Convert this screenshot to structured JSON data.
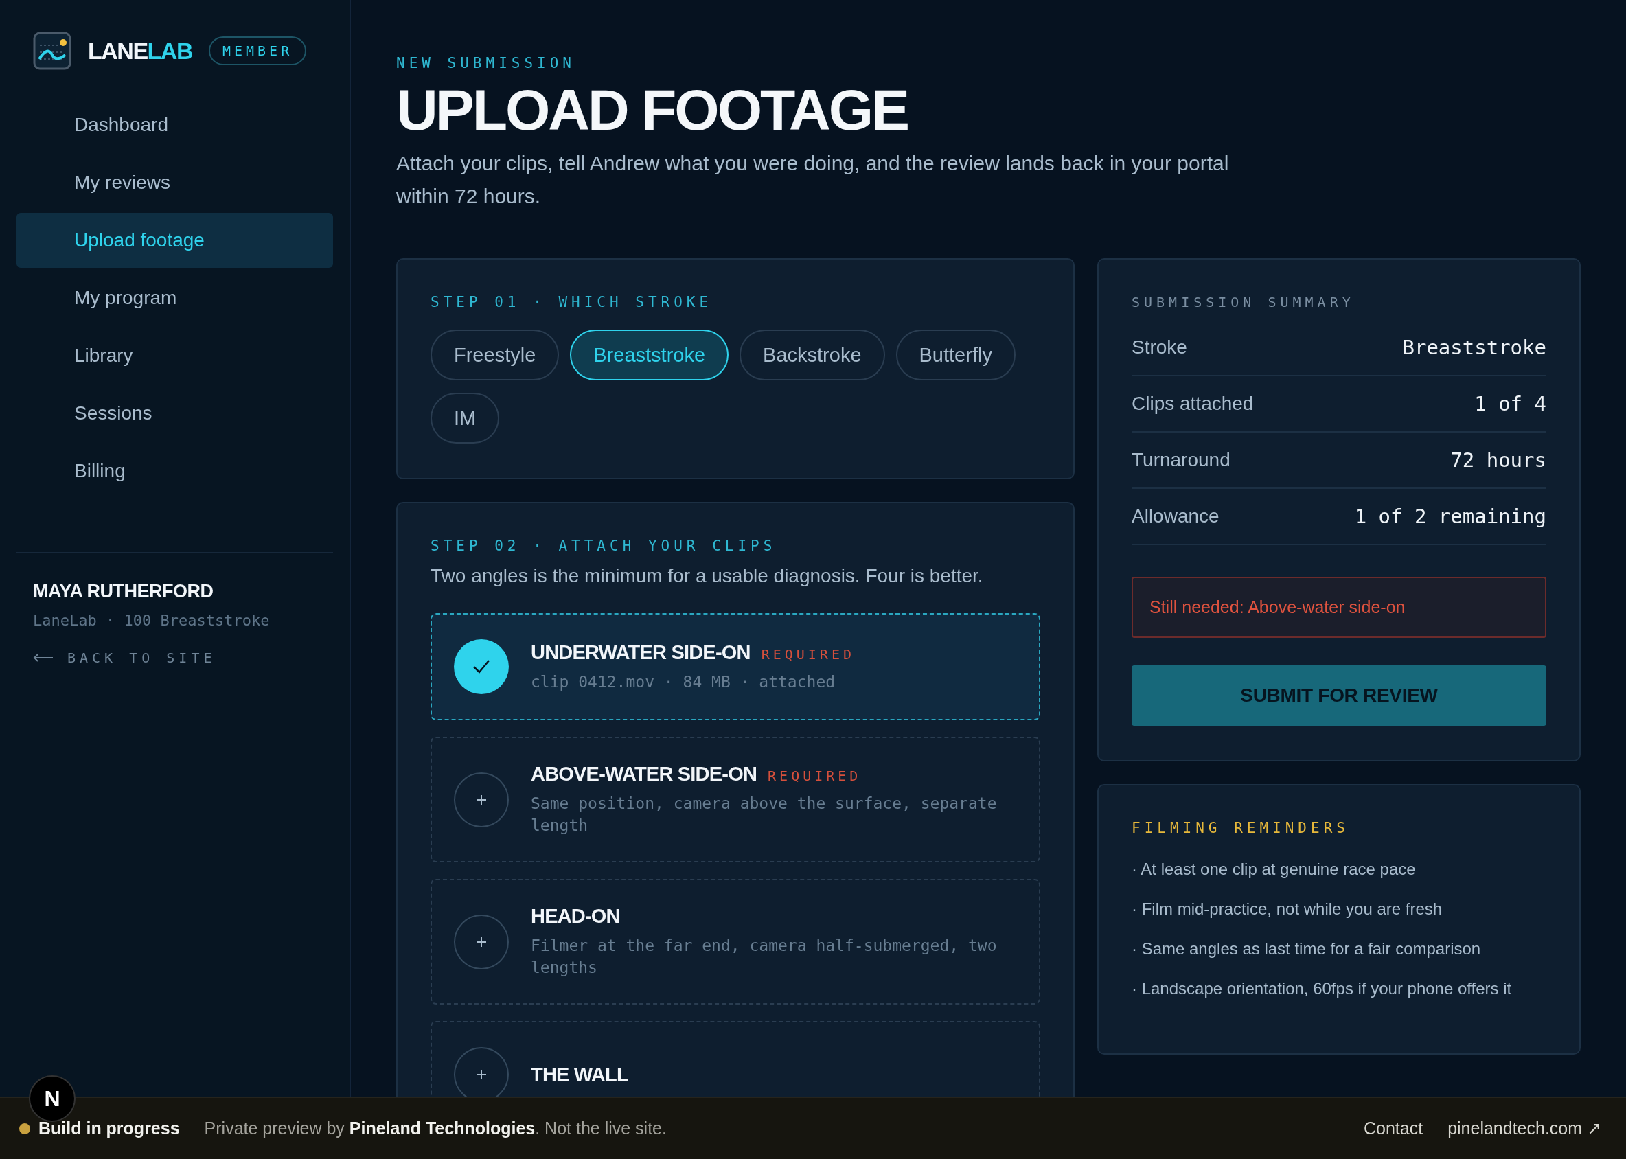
{
  "brand": {
    "name_primary": "LANE",
    "name_accent": "LAB",
    "badge": "MEMBER"
  },
  "nav": [
    {
      "label": "Dashboard",
      "selected": false
    },
    {
      "label": "My reviews",
      "selected": false
    },
    {
      "label": "Upload footage",
      "selected": true
    },
    {
      "label": "My program",
      "selected": false
    },
    {
      "label": "Library",
      "selected": false
    },
    {
      "label": "Sessions",
      "selected": false
    },
    {
      "label": "Billing",
      "selected": false
    }
  ],
  "user": {
    "name": "MAYA RUTHERFORD",
    "plan": "LaneLab · 100 Breaststroke",
    "back_link": "BACK TO SITE"
  },
  "header": {
    "eyebrow": "NEW SUBMISSION",
    "title": "UPLOAD FOOTAGE",
    "description": "Attach your clips, tell Andrew what you were doing, and the review lands back in your portal within 72 hours."
  },
  "step1": {
    "label": "STEP 01 · WHICH STROKE",
    "options": [
      {
        "label": "Freestyle",
        "selected": false
      },
      {
        "label": "Breaststroke",
        "selected": true
      },
      {
        "label": "Backstroke",
        "selected": false
      },
      {
        "label": "Butterfly",
        "selected": false
      },
      {
        "label": "IM",
        "selected": false
      }
    ]
  },
  "step2": {
    "label": "STEP 02 · ATTACH YOUR CLIPS",
    "intro": "Two angles is the minimum for a usable diagnosis. Four is better.",
    "clips": [
      {
        "title": "UNDERWATER SIDE-ON",
        "tag": "REQUIRED",
        "detail": "clip_0412.mov · 84 MB · attached",
        "attached": true
      },
      {
        "title": "ABOVE-WATER SIDE-ON",
        "tag": "REQUIRED",
        "detail": "Same position, camera above the surface, separate length",
        "attached": false
      },
      {
        "title": "HEAD-ON",
        "detail": "Filmer at the far end, camera half-submerged, two lengths",
        "attached": false
      },
      {
        "title": "THE WALL",
        "attached": false
      }
    ]
  },
  "summary": {
    "heading": "SUBMISSION SUMMARY",
    "rows": [
      {
        "label": "Stroke",
        "value": "Breaststroke"
      },
      {
        "label": "Clips attached",
        "value": "1 of 4"
      },
      {
        "label": "Turnaround",
        "value": "72 hours"
      },
      {
        "label": "Allowance",
        "value": "1 of 2 remaining"
      }
    ],
    "alert": "Still needed: Above-water side-on",
    "submit": "SUBMIT FOR REVIEW"
  },
  "reminders": {
    "heading": "FILMING REMINDERS",
    "items": [
      "· At least one clip at genuine race pace",
      "· Film mid-practice, not while you are fresh",
      "· Same angles as last time for a fair comparison",
      "· Landscape orientation, 60fps if your phone offers it"
    ]
  },
  "footer": {
    "dev_badge": "N",
    "status": {
      "label": "Build in progress",
      "color": "#c9a13f"
    },
    "note": "Private preview by **Pineland Technologies**. Not the live site.",
    "links": [
      "Contact",
      "pinelandtech.com ↗"
    ]
  }
}
